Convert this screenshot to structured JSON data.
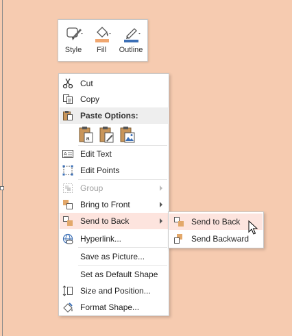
{
  "colors": {
    "canvas": "#f6cbb0",
    "hover": "#fde4de",
    "accent_blue": "#3b6fb6",
    "accent_orange": "#f0a770"
  },
  "mini_toolbar": {
    "buttons": [
      {
        "label": "Style",
        "icon": "style-brush-icon"
      },
      {
        "label": "Fill",
        "icon": "fill-bucket-icon"
      },
      {
        "label": "Outline",
        "icon": "outline-pen-icon"
      }
    ]
  },
  "context_menu": {
    "cut": "Cut",
    "copy": "Copy",
    "paste_options": "Paste Options:",
    "paste_icons": [
      "paste-use-destination-theme-icon",
      "paste-keep-source-formatting-icon",
      "paste-picture-icon"
    ],
    "edit_text": "Edit Text",
    "edit_points": "Edit Points",
    "group": "Group",
    "bring_to_front": "Bring to Front",
    "send_to_back": "Send to Back",
    "hyperlink": "Hyperlink...",
    "save_as_picture": "Save as Picture...",
    "set_default_shape": "Set as Default Shape",
    "size_position": "Size and Position...",
    "format_shape": "Format Shape..."
  },
  "submenu": {
    "send_to_back": "Send to Back",
    "send_backward": "Send Backward"
  }
}
